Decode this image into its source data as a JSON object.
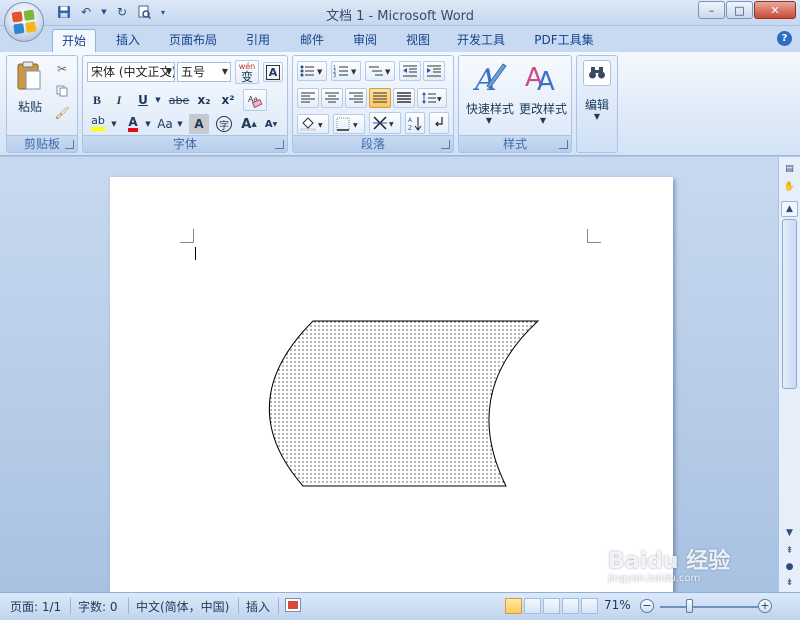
{
  "window": {
    "title": "文档 1 - Microsoft Word",
    "controls": {
      "minimize": "–",
      "maximize": "□",
      "close": "✕"
    }
  },
  "qat": {
    "icons": [
      "save-icon",
      "undo-icon",
      "redo-icon",
      "print-preview-icon",
      "customize-icon"
    ]
  },
  "tabs": [
    {
      "label": "开始",
      "active": true
    },
    {
      "label": "插入"
    },
    {
      "label": "页面布局"
    },
    {
      "label": "引用"
    },
    {
      "label": "邮件"
    },
    {
      "label": "审阅"
    },
    {
      "label": "视图"
    },
    {
      "label": "开发工具"
    },
    {
      "label": "PDF工具集"
    }
  ],
  "ribbon": {
    "clipboard": {
      "group_label": "剪贴板",
      "paste_label": "粘贴"
    },
    "font": {
      "group_label": "字体",
      "font_name": "宋体 (中文正文)",
      "font_size": "五号",
      "wen_label": "wén",
      "wen_char": "变",
      "bold": "B",
      "italic": "I",
      "underline": "U",
      "strike": "abe",
      "subscript": "x₂",
      "superscript": "x²",
      "font_color_letter": "A",
      "change_case": "Aa",
      "char_shading": "A",
      "enclose": "字",
      "grow": "A",
      "shrink": "A"
    },
    "paragraph": {
      "group_label": "段落"
    },
    "styles": {
      "group_label": "样式",
      "quick_styles": "快速样式",
      "change_styles": "更改样式"
    },
    "editing": {
      "label": "编辑"
    }
  },
  "statusbar": {
    "page": "页面: 1/1",
    "words": "字数: 0",
    "language": "中文(简体，中国)",
    "mode": "插入",
    "zoom": "71%",
    "zoom_minus": "−",
    "zoom_plus": "+"
  },
  "watermark": {
    "text": "Baidu 经验",
    "subtext": "jingyan.baidu.com"
  },
  "colors": {
    "accent": "#15428b",
    "ribbon_bg": "#dae7f7",
    "highlight": "#ffff00",
    "font_color": "#e01010"
  }
}
